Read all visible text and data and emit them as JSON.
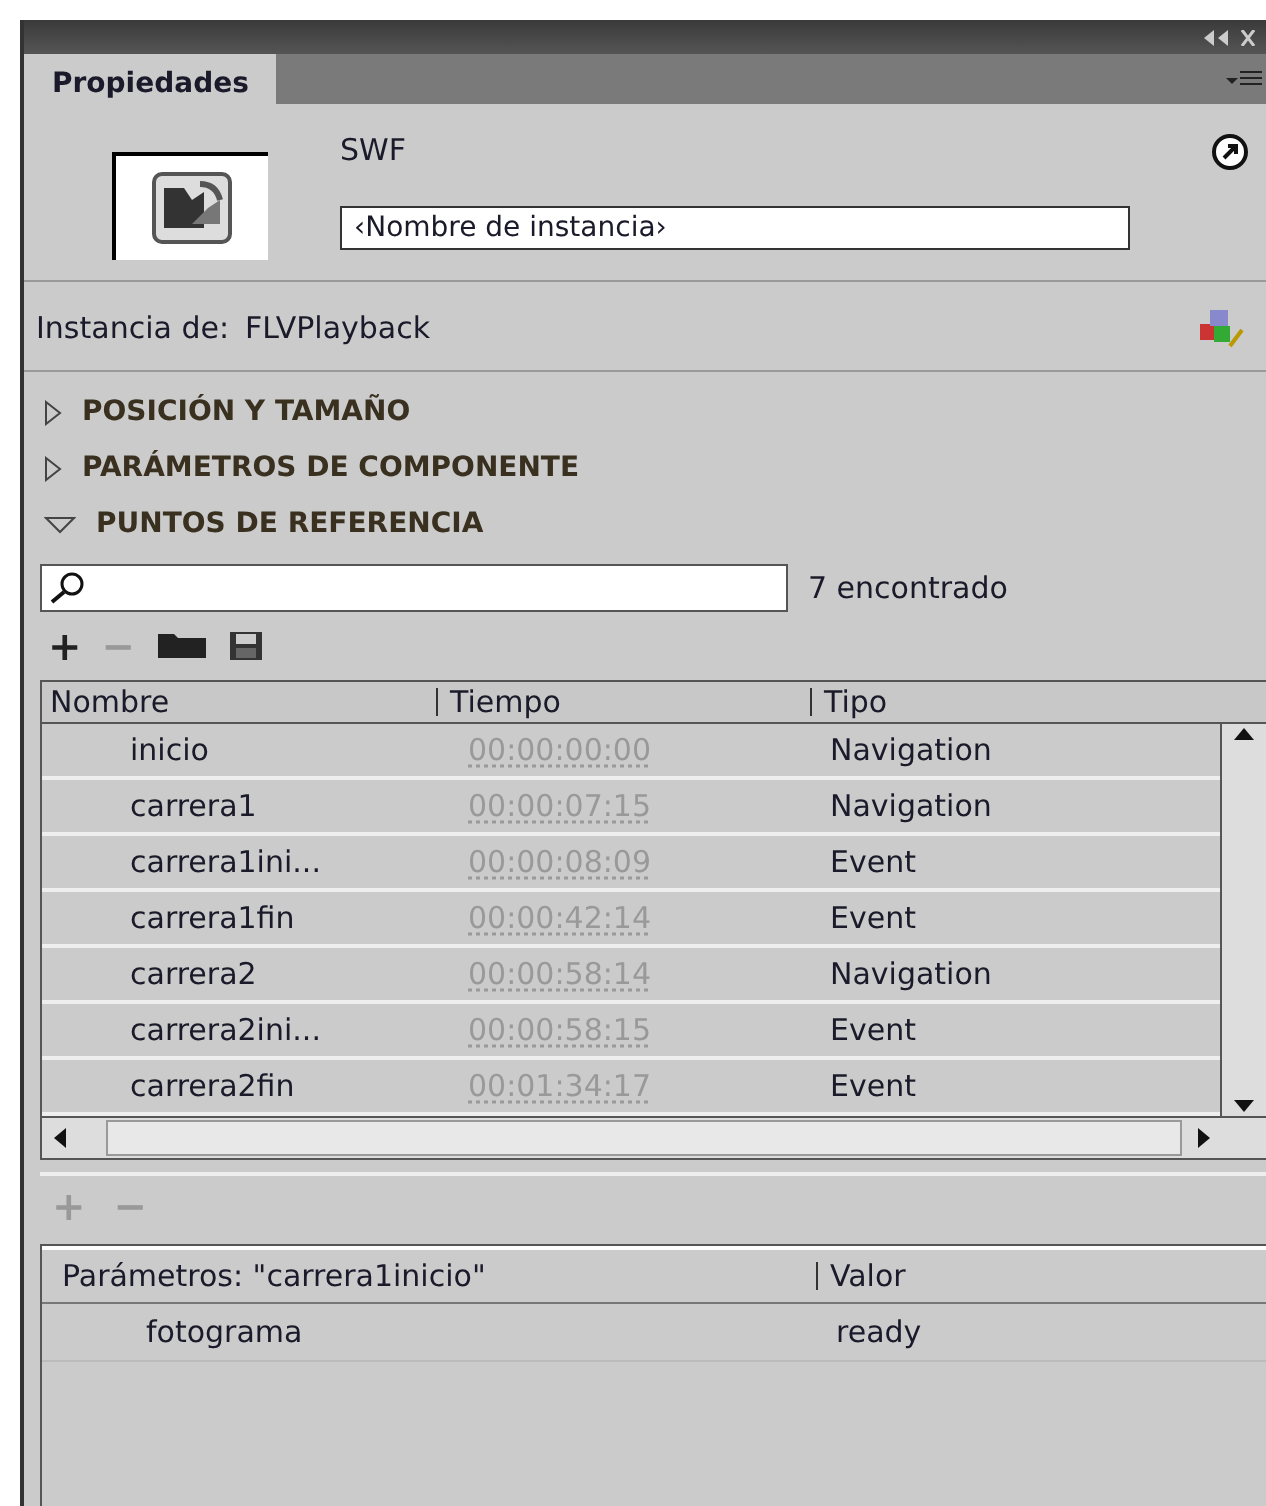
{
  "panel": {
    "tab": "Propiedades"
  },
  "header": {
    "type_label": "SWF",
    "instance_name": {
      "placeholder": "‹Nombre de instancia›"
    },
    "instance_of_label": "Instancia de:",
    "instance_of_value": "FLVPlayback"
  },
  "sections": [
    {
      "title": "POSICIÓN Y TAMAÑO",
      "expanded": false
    },
    {
      "title": "PARÁMETROS DE COMPONENTE",
      "expanded": false
    },
    {
      "title": "PUNTOS DE REFERENCIA",
      "expanded": true
    }
  ],
  "cue_points": {
    "search": {
      "found": "7 encontrado"
    },
    "toolbar": [
      {
        "kind": "add",
        "label": "+",
        "disabled": false
      },
      {
        "kind": "remove",
        "label": "−",
        "disabled": true
      },
      {
        "kind": "open",
        "disabled": false
      },
      {
        "kind": "save",
        "disabled": false
      }
    ],
    "table": {
      "columns": [
        "Nombre",
        "Tiempo",
        "Tipo"
      ],
      "rows": [
        {
          "name": "inicio",
          "time": "00:00:00:00",
          "type": "Navigation"
        },
        {
          "name": "carrera1",
          "time": "00:00:07:15",
          "type": "Navigation"
        },
        {
          "name": "carrera1ini...",
          "time": "00:00:08:09",
          "type": "Event"
        },
        {
          "name": "carrera1fin",
          "time": "00:00:42:14",
          "type": "Event"
        },
        {
          "name": "carrera2",
          "time": "00:00:58:14",
          "type": "Navigation"
        },
        {
          "name": "carrera2ini...",
          "time": "00:00:58:15",
          "type": "Event"
        },
        {
          "name": "carrera2fin",
          "time": "00:01:34:17",
          "type": "Event"
        }
      ]
    }
  },
  "parameters": {
    "toolbar": [
      {
        "label": "+",
        "disabled": true
      },
      {
        "label": "−",
        "disabled": true
      }
    ],
    "columns": [
      "Parámetros: \"carrera1inicio\"",
      "Valor"
    ],
    "rows": [
      {
        "name": "fotograma",
        "value": "ready"
      }
    ]
  }
}
